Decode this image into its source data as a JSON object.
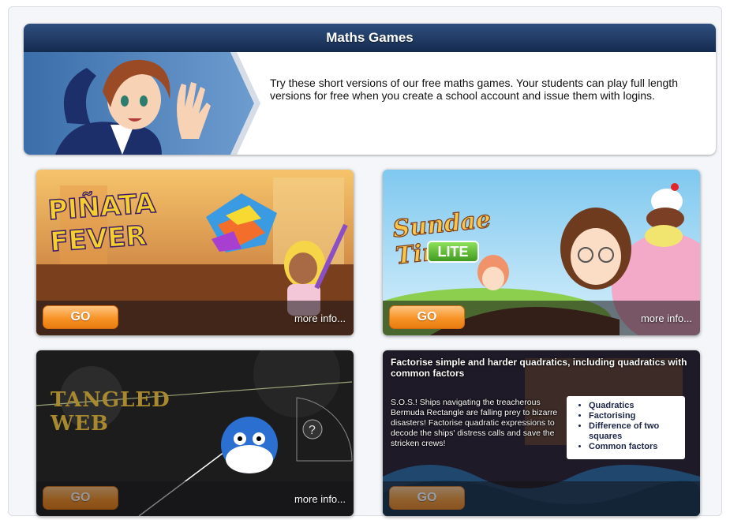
{
  "banner": {
    "title": "Maths Games",
    "description": "Try these short versions of our free maths games. Your students can play full length versions for free when you create a school account and issue them with logins."
  },
  "games": {
    "pinata": {
      "logo": "PIÑATA FEVER",
      "go": "GO",
      "more": "more info..."
    },
    "sundae": {
      "logo": "Sundae Times",
      "badge": "LITE",
      "go": "GO",
      "more": "more info..."
    },
    "angled": {
      "logo": "TANGLED WEB",
      "go": "GO",
      "more": "more info..."
    },
    "sos": {
      "go": "GO",
      "overlay_title": "Factorise simple and harder quadratics, including quadratics with common factors",
      "overlay_desc": "S.O.S.! Ships navigating the treacherous Bermuda Rectangle are falling prey to bizarre disasters! Factorise quadratic expressions to decode the ships' distress calls and save the stricken crews!",
      "topics": [
        "Quadratics",
        "Factorising",
        "Difference of two squares",
        "Common factors"
      ]
    }
  },
  "colors": {
    "header_navy": "#1e3a64",
    "go_orange": "#f79327"
  }
}
